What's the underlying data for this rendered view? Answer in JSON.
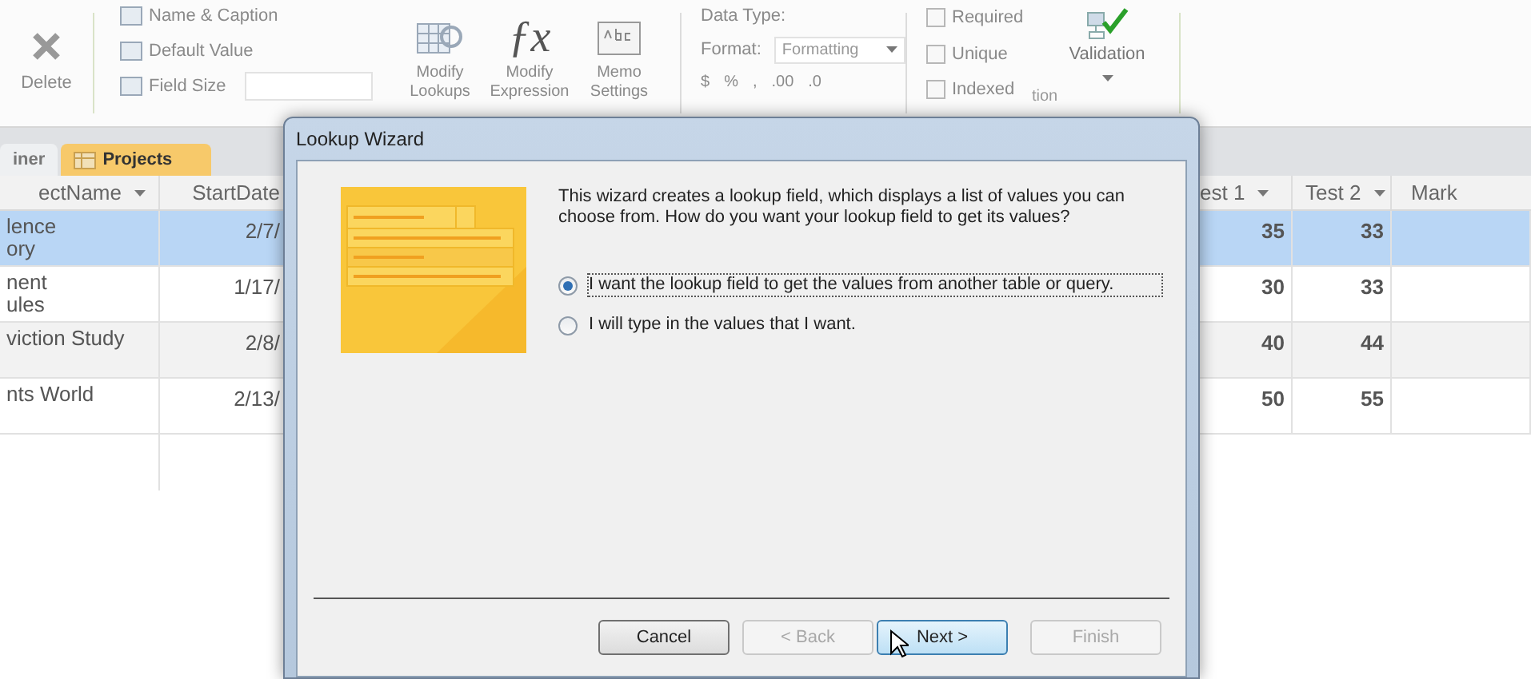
{
  "ribbon": {
    "delete_label": "Delete",
    "field_commands": [
      "Name & Caption",
      "Default Value",
      "Field Size"
    ],
    "large_buttons": [
      {
        "kind": "lookups",
        "label": "Modify Lookups"
      },
      {
        "kind": "expression",
        "label": "Modify Expression",
        "icon_text": "ƒx"
      },
      {
        "kind": "memo",
        "label": "Memo Settings"
      }
    ],
    "data_type_label": "Data Type:",
    "format_label": "Format:",
    "format_value": "Formatting",
    "number_symbols": [
      "$",
      "%",
      ",",
      ".00",
      ".0"
    ],
    "checks": [
      {
        "label": "Required",
        "checked": false
      },
      {
        "label": "Unique",
        "checked": false
      },
      {
        "label": "Indexed",
        "checked": false
      }
    ],
    "validation_label": "Validation",
    "group_label": "tion"
  },
  "tabs": [
    {
      "label": "iner",
      "selected": false
    },
    {
      "label": "Projects",
      "selected": true
    }
  ],
  "table": {
    "columns_left": [
      "ectName",
      "StartDate"
    ],
    "columns_right": [
      "est 1",
      "Test 2",
      "Mark"
    ],
    "rows": [
      {
        "name": [
          "lence",
          "ory"
        ],
        "start": "2/7/",
        "test1": "35",
        "test2": "33",
        "selected": true
      },
      {
        "name": [
          "nent",
          "ules"
        ],
        "start": "1/17/",
        "test1": "30",
        "test2": "33",
        "selected": false
      },
      {
        "name": [
          "viction Study"
        ],
        "start": "2/8/",
        "test1": "40",
        "test2": "44",
        "selected": false
      },
      {
        "name": [
          "nts World"
        ],
        "start": "2/13/",
        "test1": "50",
        "test2": "55",
        "selected": false
      }
    ]
  },
  "dialog": {
    "title": "Lookup Wizard",
    "intro": "This wizard creates a lookup field, which displays a list of values you can choose from.  How do you want your lookup field to get its values?",
    "options": [
      {
        "label": "I want the lookup field to get the values from another table or query.",
        "selected": true
      },
      {
        "label": "I will type in the values that I want.",
        "selected": false
      }
    ],
    "buttons": [
      {
        "label": "Cancel",
        "disabled": false,
        "focused": false
      },
      {
        "label": "< Back",
        "disabled": true,
        "focused": false
      },
      {
        "label": "Next >",
        "disabled": false,
        "focused": true
      },
      {
        "label": "Finish",
        "disabled": true,
        "focused": false
      }
    ]
  }
}
